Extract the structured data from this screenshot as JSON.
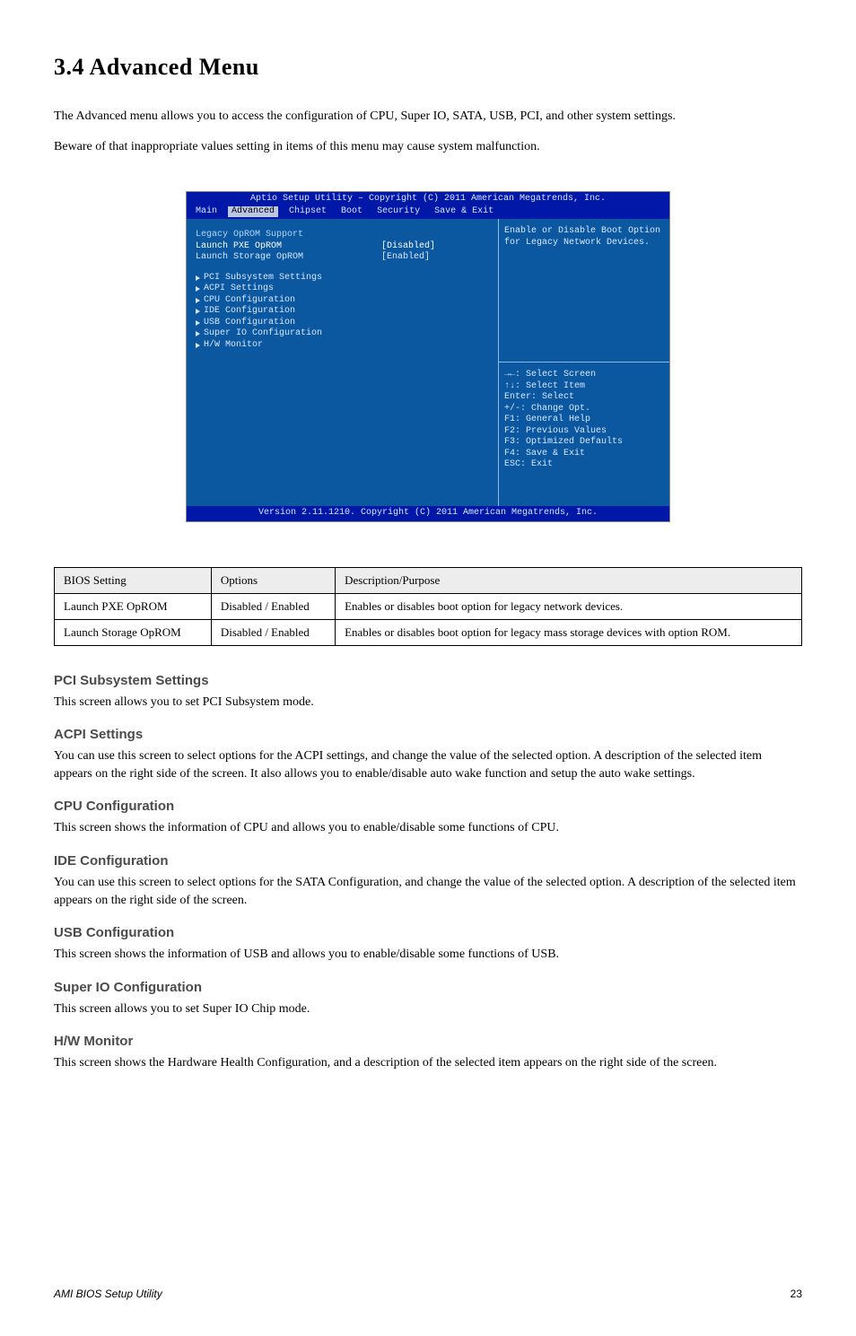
{
  "section": {
    "title": "3.4 Advanced Menu"
  },
  "intro_paragraphs": [
    "The Advanced menu allows you to access the configuration of CPU, Super IO, SATA, USB, PCI, and other system settings.",
    "Beware of that inappropriate values setting in items of this menu may cause system malfunction."
  ],
  "bios": {
    "title_line": "Aptio Setup Utility – Copyright (C) 2011 American Megatrends, Inc.",
    "footer_line": "Version 2.11.1210. Copyright (C) 2011 American Megatrends, Inc.",
    "tabs": [
      "Main",
      "Advanced",
      "Chipset",
      "Boot",
      "Security",
      "Save & Exit"
    ],
    "active_tab": "Advanced",
    "section_heading": "Legacy OpROM Support",
    "rows": [
      {
        "label": "Launch PXE OpROM",
        "value": "[Disabled]",
        "selected": true
      },
      {
        "label": "Launch Storage OpROM",
        "value": "[Enabled]",
        "selected": false
      }
    ],
    "submenus": [
      "PCI Subsystem Settings",
      "ACPI Settings",
      "CPU Configuration",
      "IDE Configuration",
      "USB Configuration",
      "Super IO Configuration",
      "H/W Monitor"
    ],
    "help_top": [
      "Enable or Disable Boot Option",
      "for Legacy Network Devices."
    ],
    "help_keys": [
      "→←: Select Screen",
      "↑↓: Select Item",
      "Enter: Select",
      "+/-: Change Opt.",
      "F1: General Help",
      "F2: Previous Values",
      "F3: Optimized Defaults",
      "F4: Save & Exit",
      "ESC: Exit"
    ]
  },
  "settings_table": {
    "headers": [
      "BIOS Setting",
      "Options",
      "Description/Purpose"
    ],
    "rows": [
      [
        "Launch PXE OpROM",
        "Disabled / Enabled",
        "Enables or disables boot option for legacy network devices."
      ],
      [
        "Launch Storage OpROM",
        "Disabled / Enabled",
        "Enables or disables boot option for legacy mass storage devices with option ROM."
      ]
    ]
  },
  "subsections": [
    {
      "title": "PCI Subsystem Settings",
      "body": "This screen allows you to set PCI Subsystem mode."
    },
    {
      "title": "ACPI Settings",
      "body": "You can use this screen to select options for the ACPI settings, and change the value of the selected option. A description of the selected item appears on the right side of the screen. It also allows you to enable/disable auto wake function and setup the auto wake settings."
    },
    {
      "title": "CPU Configuration",
      "body": "This screen shows the information of CPU and allows you to enable/disable some functions of CPU."
    },
    {
      "title": "IDE Configuration",
      "body": "You can use this screen to select options for the SATA Configuration, and change the value of the selected option. A description of the selected item appears on the right side of the screen."
    },
    {
      "title": "USB Configuration",
      "body": "This screen shows the information of USB and allows you to enable/disable some functions of USB."
    },
    {
      "title": "Super IO Configuration",
      "body": "This screen allows you to set Super IO Chip mode."
    },
    {
      "title": "H/W Monitor",
      "body": "This screen shows the Hardware Health Configuration, and a description of the selected item appears on the right side of the screen."
    }
  ],
  "footer": {
    "left": "AMI BIOS Setup Utility",
    "right": "23"
  }
}
